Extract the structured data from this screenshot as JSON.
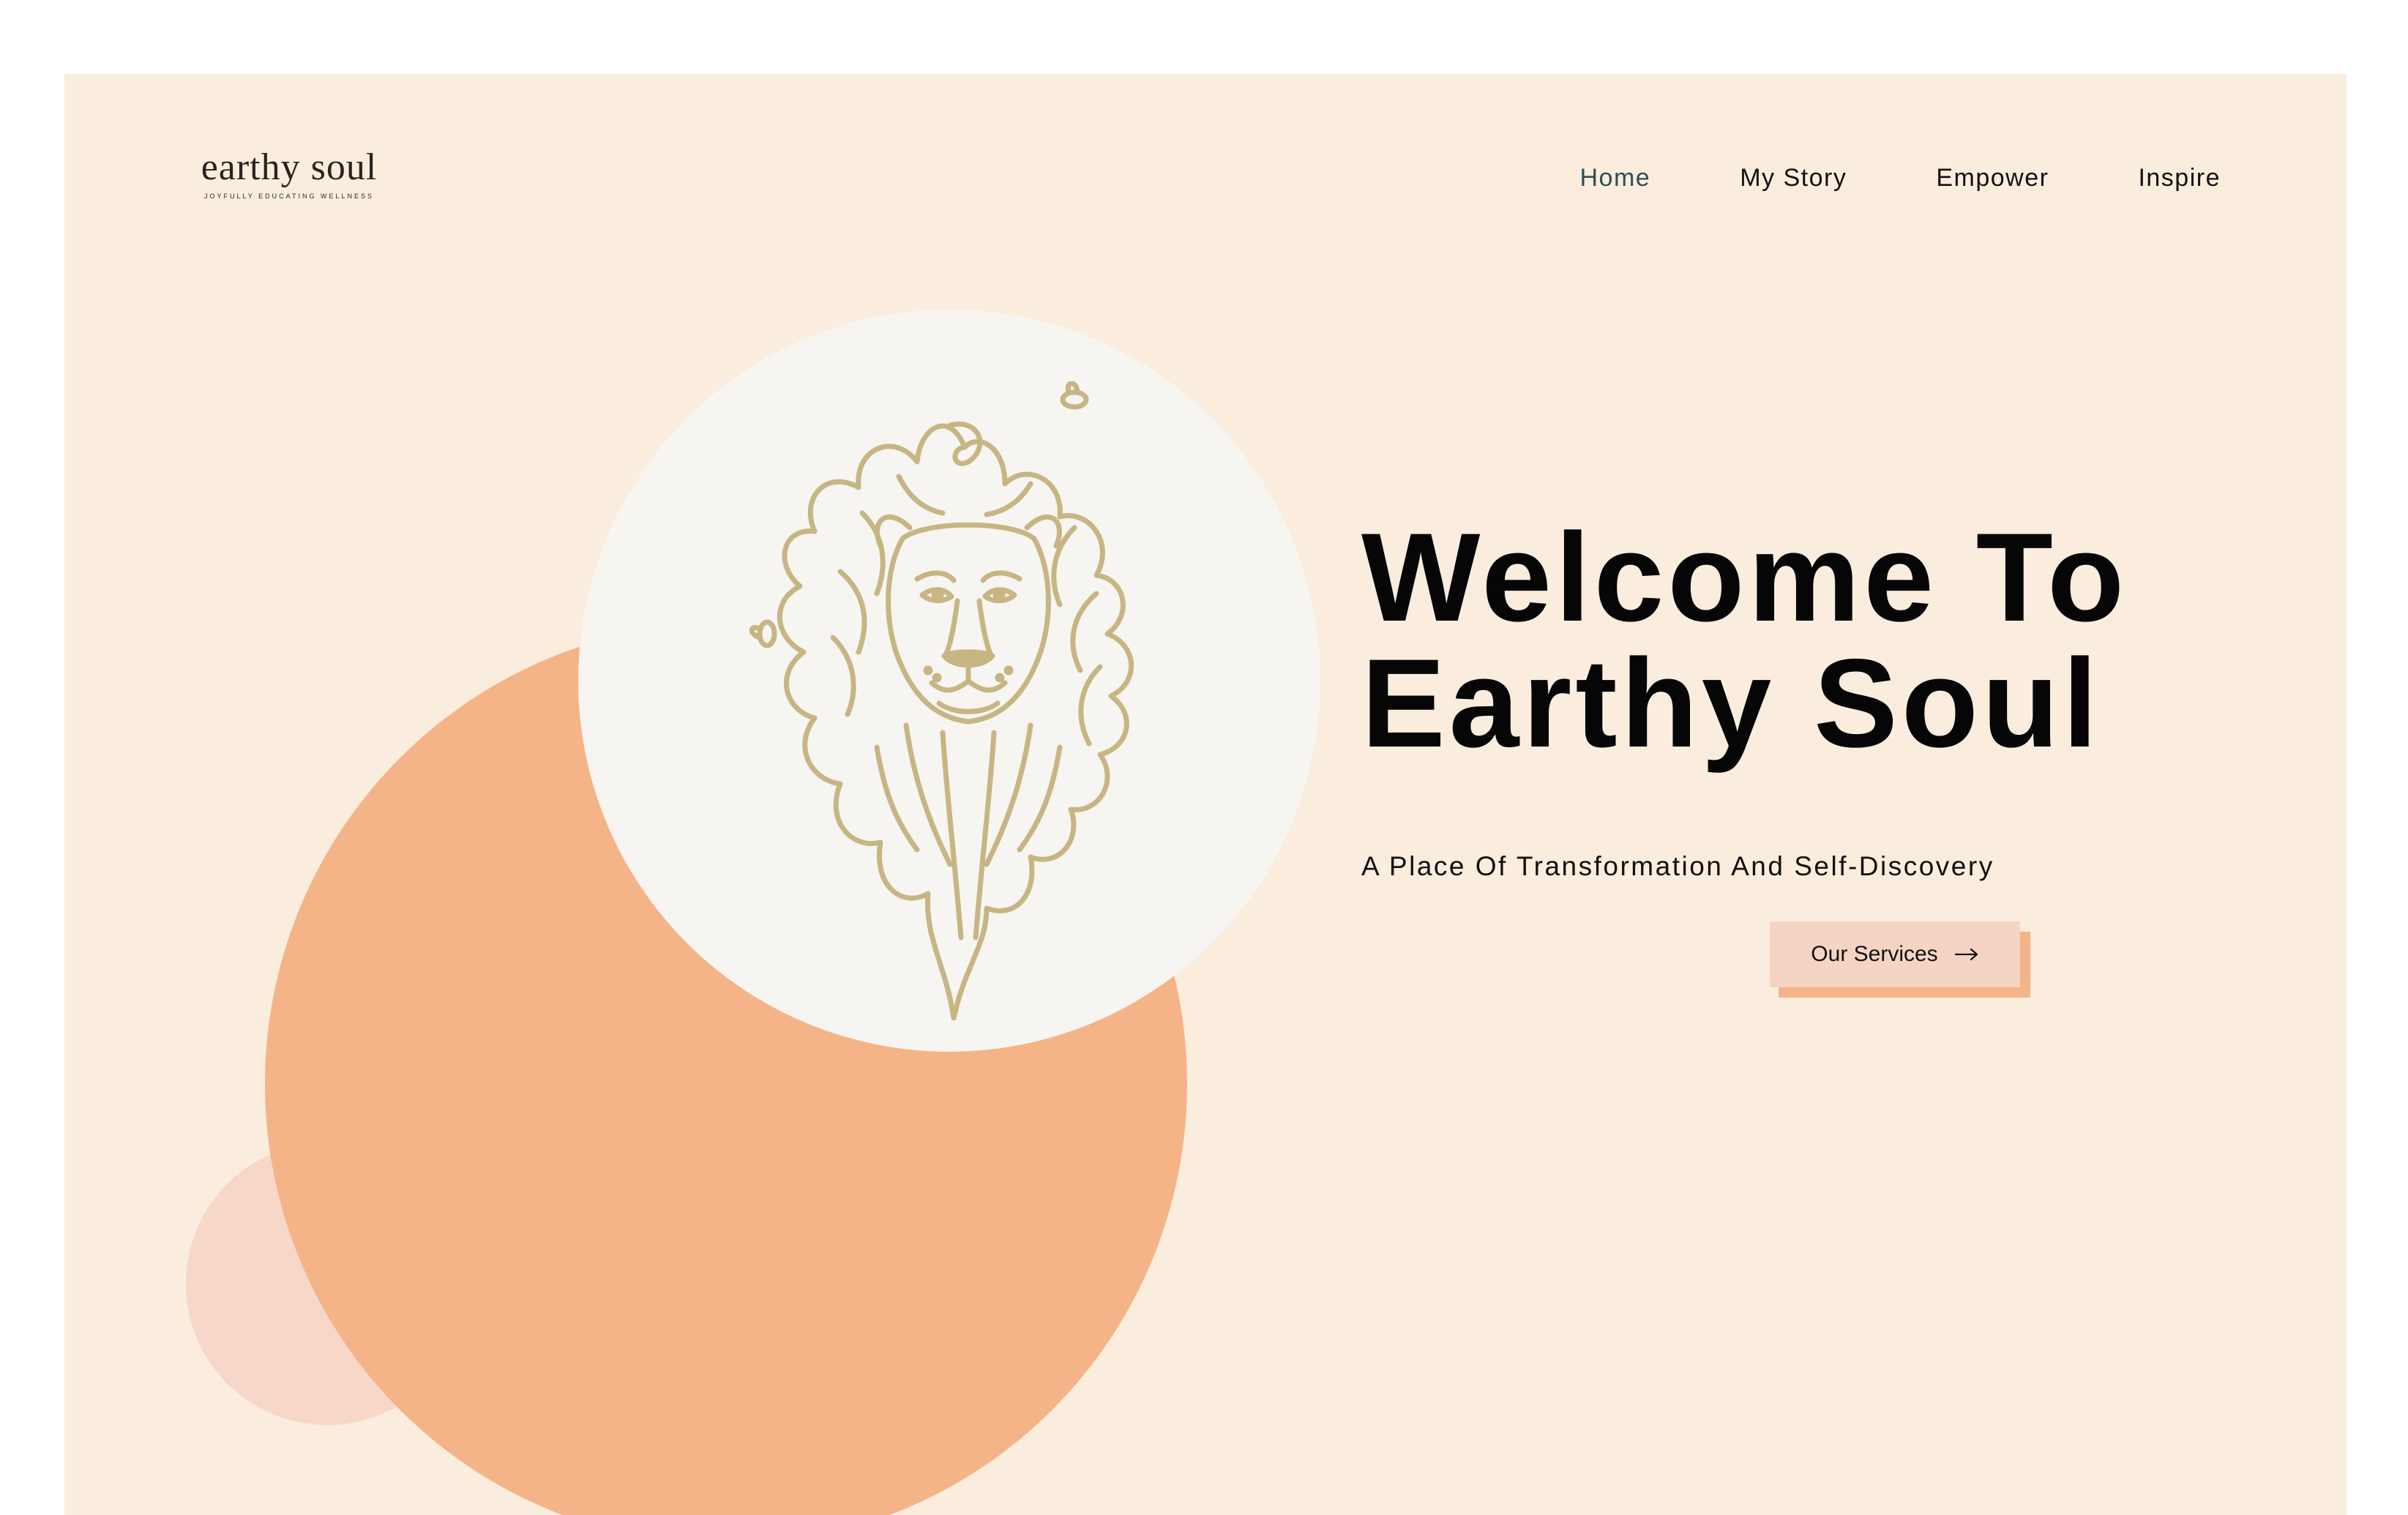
{
  "brand": {
    "name": "earthy soul",
    "tagline": "JOYFULLY EDUCATING WELLNESS"
  },
  "nav": {
    "items": [
      {
        "label": "Home",
        "active": true
      },
      {
        "label": "My Story",
        "active": false
      },
      {
        "label": "Empower",
        "active": false
      },
      {
        "label": "Inspire",
        "active": false
      }
    ]
  },
  "hero": {
    "title_line1": "Welcome To",
    "title_line2": "Earthy Soul",
    "subtitle": "A Place Of Transformation And Self-Discovery",
    "cta_label": "Our Services",
    "cta_icon": "arrow-right-icon",
    "illustration": "lion-icon"
  },
  "colors": {
    "background": "#FAEDDE",
    "accent_orange": "#F4B488",
    "accent_pink": "#F6D7C8",
    "circle_white": "#F7F5F1",
    "lion_gold": "#C7B584",
    "active_nav": "#2e4e57",
    "text": "#060606"
  }
}
